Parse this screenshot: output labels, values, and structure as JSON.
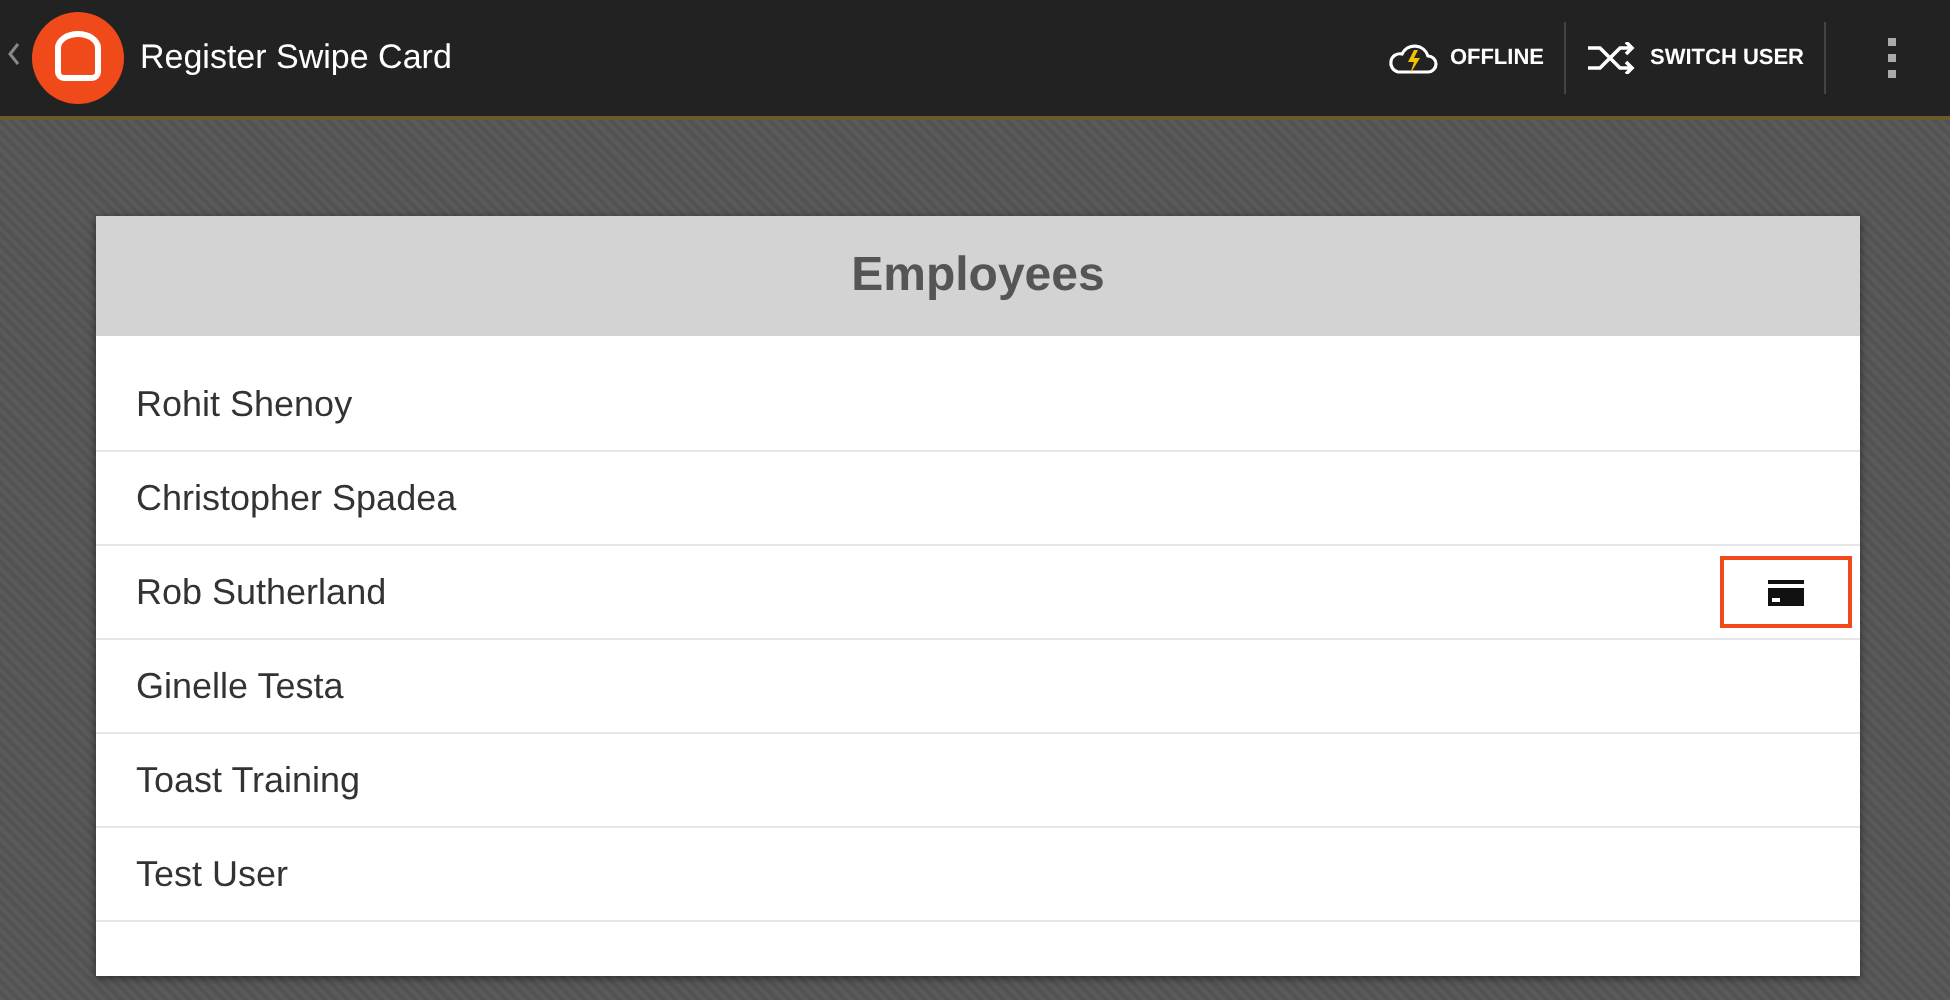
{
  "app_bar": {
    "title": "Register Swipe Card",
    "actions": [
      {
        "kind": "offline",
        "label": "OFFLINE"
      },
      {
        "kind": "switch",
        "label": "SWITCH USER"
      }
    ]
  },
  "panel": {
    "title": "Employees",
    "rows": [
      {
        "name": "Rohit Shenoy",
        "has_card": false
      },
      {
        "name": "Christopher Spadea",
        "has_card": false
      },
      {
        "name": "Rob Sutherland",
        "has_card": true
      },
      {
        "name": "Ginelle Testa",
        "has_card": false
      },
      {
        "name": "Toast Training",
        "has_card": false
      },
      {
        "name": "Test User",
        "has_card": false
      }
    ]
  }
}
